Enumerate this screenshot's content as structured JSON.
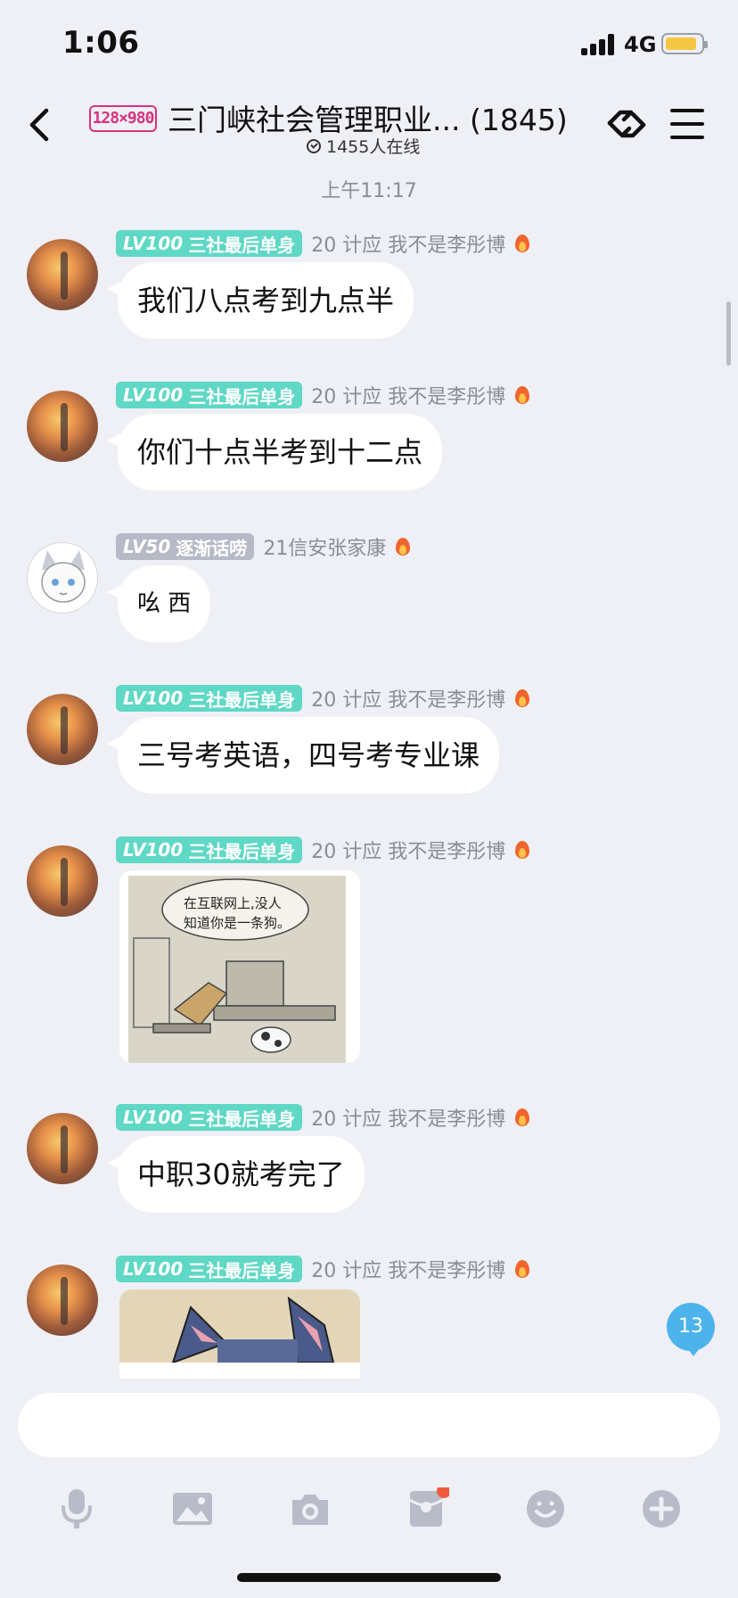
{
  "status_bar": {
    "time": "1:06",
    "network": "4G"
  },
  "header": {
    "logo_text": "128×980",
    "title": "三门峡社会管理职业...",
    "member_count": "(1845)",
    "online_text": "1455人在线"
  },
  "chat": {
    "time_separator": "上午11:17",
    "unread_count": "13",
    "messages": [
      {
        "lv_label": "LV100",
        "title": "三社最后单身",
        "sender": "20 计应  我不是李彤博",
        "text": "我们八点考到九点半"
      },
      {
        "lv_label": "LV100",
        "title": "三社最后单身",
        "sender": "20 计应  我不是李彤博",
        "text": "你们十点半考到十二点"
      },
      {
        "lv_label": "LV50",
        "title": "逐渐话唠",
        "sender": "21信安张家康",
        "text": "吆 西"
      },
      {
        "lv_label": "LV100",
        "title": "三社最后单身",
        "sender": "20 计应  我不是李彤博",
        "text": "三号考英语，四号考专业课"
      },
      {
        "lv_label": "LV100",
        "title": "三社最后单身",
        "sender": "20 计应  我不是李彤博",
        "image_caption_line1": "在互联网上,没人",
        "image_caption_line2": "知道你是一条狗。"
      },
      {
        "lv_label": "LV100",
        "title": "三社最后单身",
        "sender": "20 计应  我不是李彤博",
        "text": "中职30就考完了"
      },
      {
        "lv_label": "LV100",
        "title": "三社最后单身",
        "sender": "20 计应  我不是李彤博"
      }
    ]
  },
  "input": {
    "placeholder": ""
  },
  "toolbar_icons": [
    "microphone-icon",
    "image-icon",
    "camera-icon",
    "red-packet-icon",
    "emoji-icon",
    "plus-icon"
  ],
  "colors": {
    "accent": "#4db3ed",
    "lv_teal": "#5fd8c5",
    "lv_gray": "#b7b9c6",
    "flame": "#f0642d",
    "battery": "#f6c744"
  }
}
